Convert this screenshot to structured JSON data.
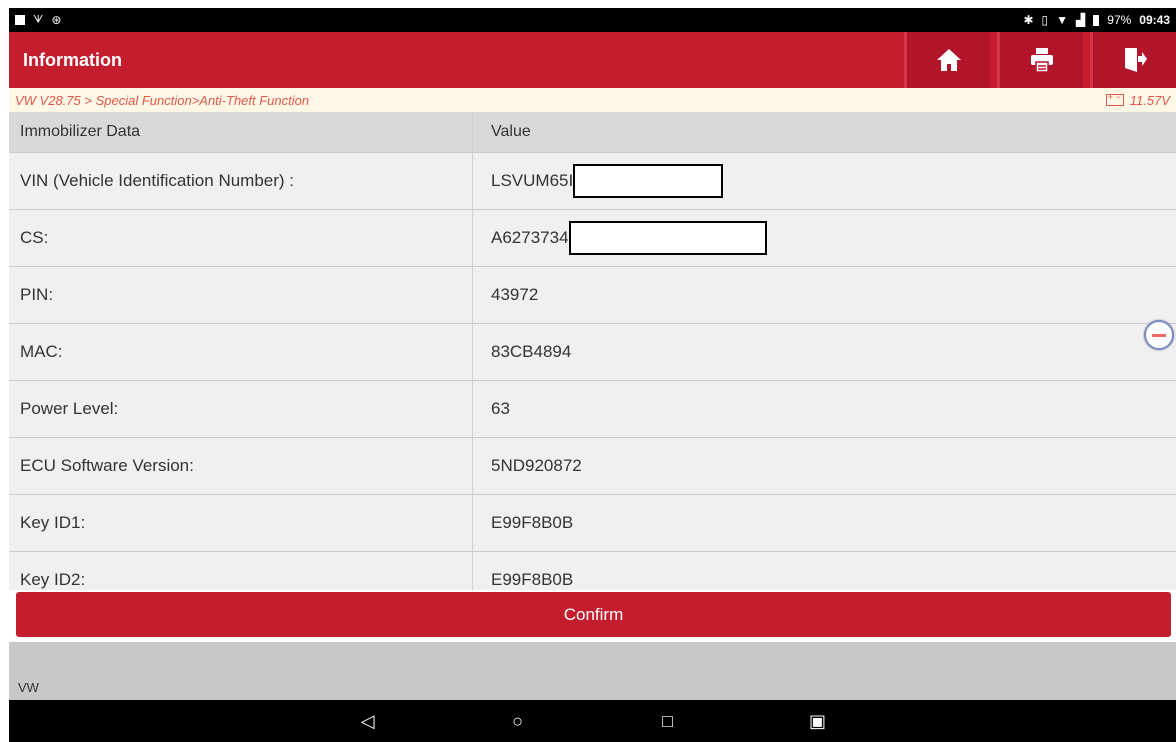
{
  "status_bar": {
    "battery": "97%",
    "time": "09:43"
  },
  "header": {
    "title": "Information"
  },
  "breadcrumb": {
    "path": "VW V28.75 > Special Function>Anti-Theft Function",
    "voltage": "11.57V"
  },
  "table": {
    "headers": [
      "Immobilizer Data",
      "Value"
    ],
    "rows": [
      {
        "name": "VIN (Vehicle Identification Number) :",
        "value": "LSVUM65I"
      },
      {
        "name": "CS:",
        "value": "A6273734"
      },
      {
        "name": "PIN:",
        "value": "43972"
      },
      {
        "name": "MAC:",
        "value": "83CB4894"
      },
      {
        "name": "Power Level:",
        "value": "63"
      },
      {
        "name": "ECU Software Version:",
        "value": "5ND920872"
      },
      {
        "name": "Key ID1:",
        "value": "E99F8B0B"
      },
      {
        "name": "Key ID2:",
        "value": "E99F8B0B"
      }
    ]
  },
  "confirm": {
    "label": "Confirm"
  },
  "footer": {
    "label": "VW"
  },
  "colors": {
    "brand_red": "#c41e2e",
    "breadcrumb_text": "#e0574c"
  },
  "icons": [
    "home-icon",
    "print-icon",
    "exit-icon",
    "back-icon",
    "home-nav-icon",
    "recents-icon",
    "screenshot-icon"
  ]
}
